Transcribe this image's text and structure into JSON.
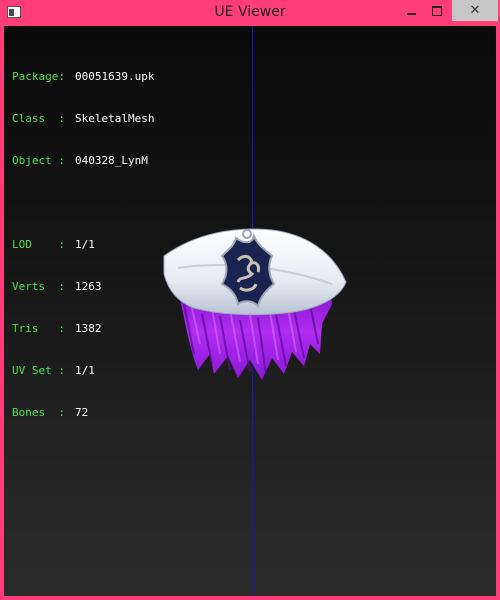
{
  "window": {
    "title": "UE Viewer",
    "icon": "app-window-icon",
    "controls": {
      "minimize_icon": "minimize-icon",
      "maximize_icon": "maximize-icon",
      "close_label": "✕"
    }
  },
  "info": {
    "package": {
      "label": "Package:",
      "value": "00051639.upk"
    },
    "class": {
      "label": "Class  :",
      "value": "SkeletalMesh"
    },
    "object": {
      "label": "Object :",
      "value": "040328_LynM"
    },
    "lod": {
      "label": "LOD    :",
      "value": "1/1"
    },
    "verts": {
      "label": "Verts  :",
      "value": "1263"
    },
    "tris": {
      "label": "Tris   :",
      "value": "1382"
    },
    "uvset": {
      "label": "UV Set :",
      "value": "1/1"
    },
    "bones": {
      "label": "Bones  :",
      "value": "72"
    }
  },
  "colors": {
    "frame": "#ff3d78",
    "label_green": "#4ddf4d",
    "value_white": "#ffffff",
    "axis_blue": "#1414c8",
    "hair_purple": "#9a1fe0",
    "hat_white": "#eef2f8",
    "emblem_navy": "#1b2450"
  }
}
